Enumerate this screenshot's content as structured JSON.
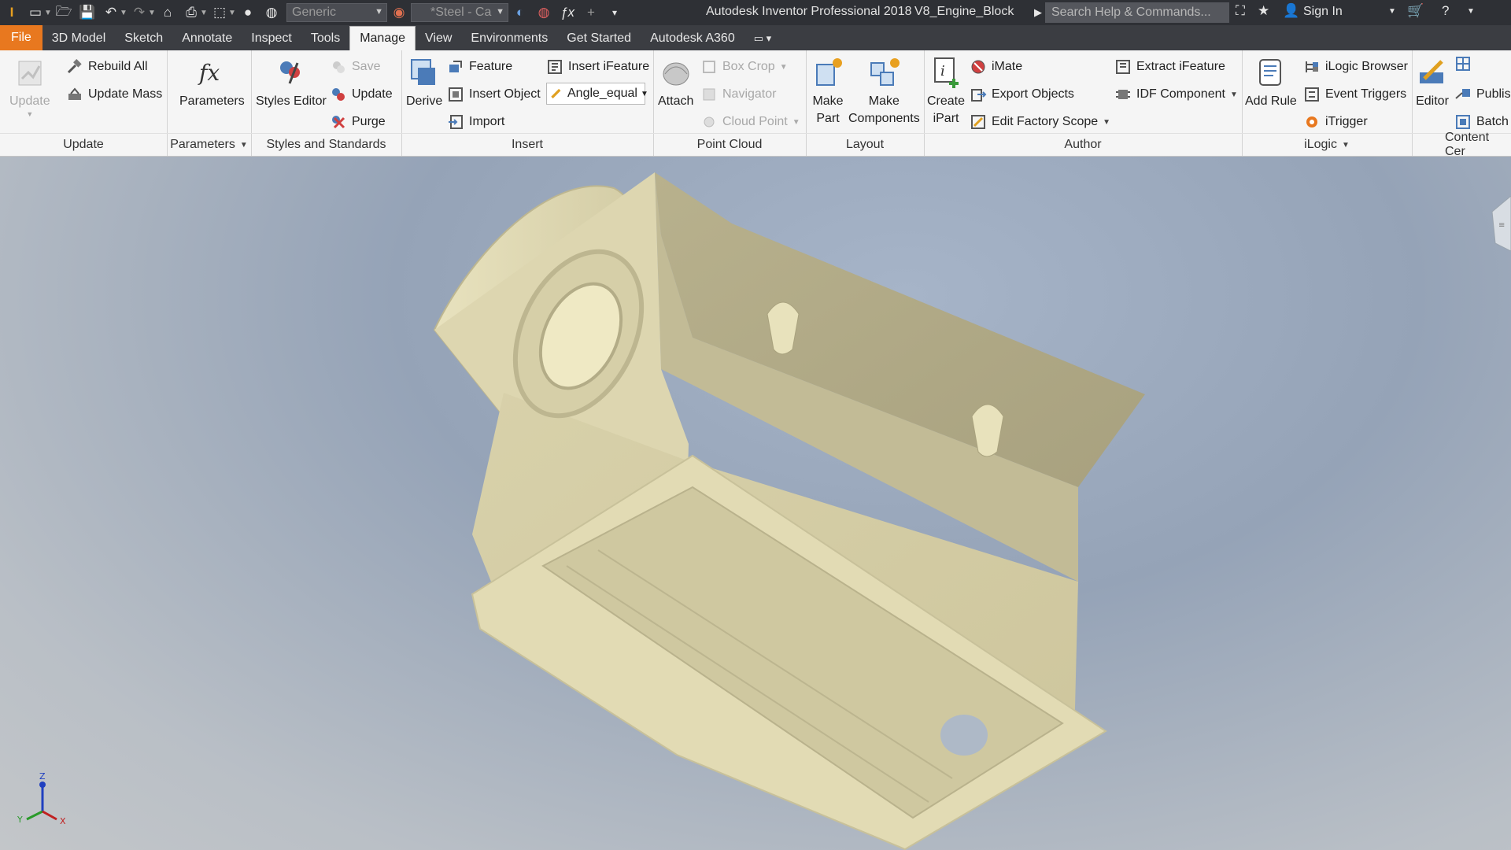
{
  "titlebar": {
    "appearance_combo": "Generic",
    "material_combo": "*Steel - Ca",
    "app_title": "Autodesk Inventor Professional 2018",
    "document_title": "V8_Engine_Block",
    "search_placeholder": "Search Help & Commands...",
    "sign_in": "Sign In"
  },
  "tabs": [
    "File",
    "3D Model",
    "Sketch",
    "Annotate",
    "Inspect",
    "Tools",
    "Manage",
    "View",
    "Environments",
    "Get Started",
    "Autodesk A360"
  ],
  "active_tab": "Manage",
  "ribbon": {
    "update": {
      "update": "Update",
      "rebuild_all": "Rebuild All",
      "update_mass": "Update Mass",
      "title": "Update"
    },
    "parameters": {
      "parameters": "Parameters",
      "title": "Parameters"
    },
    "styles": {
      "styles_editor": "Styles Editor",
      "save": "Save",
      "update": "Update",
      "purge": "Purge",
      "title": "Styles and Standards"
    },
    "insert": {
      "derive": "Derive",
      "feature": "Feature",
      "insert_object": "Insert Object",
      "import": "Import",
      "insert_ifeature": "Insert iFeature",
      "angle_combo": "Angle_equal",
      "title": "Insert"
    },
    "point_cloud": {
      "attach": "Attach",
      "box_crop": "Box Crop",
      "navigator": "Navigator",
      "cloud_point": "Cloud Point",
      "title": "Point Cloud"
    },
    "layout": {
      "make_part_1": "Make",
      "make_part_2": "Part",
      "make_components_1": "Make",
      "make_components_2": "Components",
      "title": "Layout"
    },
    "author": {
      "create_ipart_1": "Create",
      "create_ipart_2": "iPart",
      "imate": "iMate",
      "export_objects": "Export Objects",
      "edit_factory_scope": "Edit Factory Scope",
      "extract_ifeature": "Extract iFeature",
      "idf_component": "IDF Component",
      "title": "Author"
    },
    "ilogic": {
      "add_rule": "Add Rule",
      "ilogic_browser": "iLogic Browser",
      "event_triggers": "Event Triggers",
      "itrigger": "iTrigger",
      "title": "iLogic"
    },
    "content_center": {
      "editor": "Editor",
      "publish": "Publis",
      "batch": "Batch",
      "title": "Content Cer"
    }
  },
  "triad": {
    "x": "X",
    "y": "Y",
    "z": "Z"
  },
  "colors": {
    "file_tab": "#e8781f",
    "model": "#d9d2a8",
    "title_bar": "#2e3035"
  }
}
